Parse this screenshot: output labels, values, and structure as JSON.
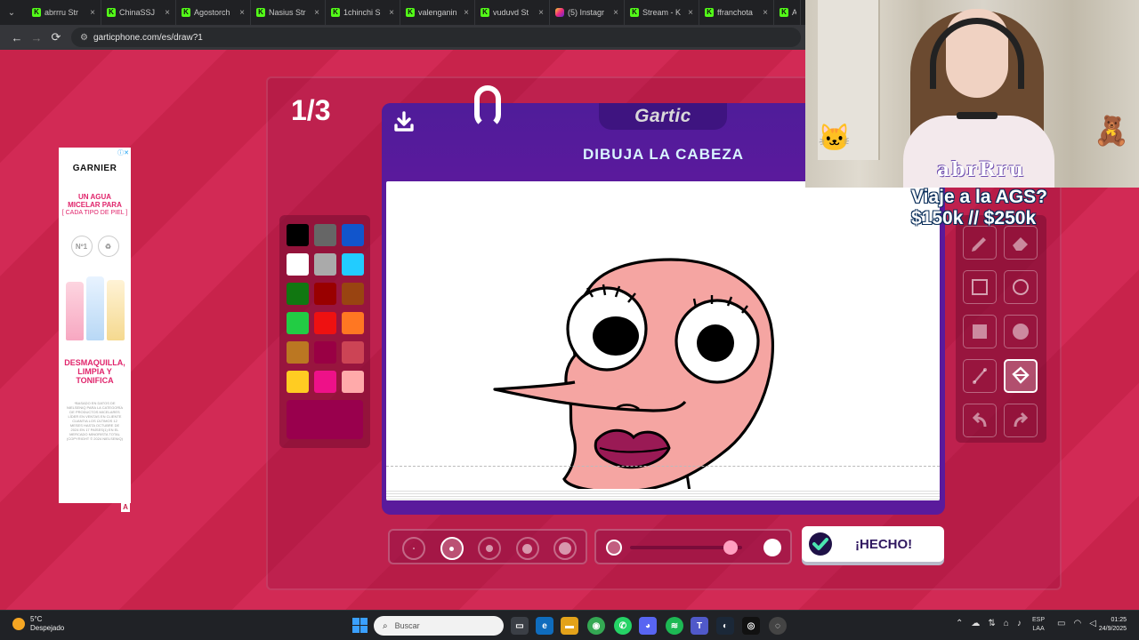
{
  "browser": {
    "tabs": [
      {
        "label": "abrrru Str",
        "icon": "kick-icon"
      },
      {
        "label": "ChinaSSJ",
        "icon": "kick-icon"
      },
      {
        "label": "Agostorch",
        "icon": "kick-icon"
      },
      {
        "label": "Nasius Str",
        "icon": "kick-icon"
      },
      {
        "label": "1chinchi S",
        "icon": "kick-icon"
      },
      {
        "label": "valenganin",
        "icon": "kick-icon"
      },
      {
        "label": "vuduvd St",
        "icon": "kick-icon"
      },
      {
        "label": "(5) Instagr",
        "icon": "instagram-icon"
      },
      {
        "label": "Stream - K",
        "icon": "kick-icon"
      },
      {
        "label": "ffranchota",
        "icon": "kick-icon"
      },
      {
        "label": "A",
        "icon": "kick-icon"
      }
    ],
    "url": "garticphone.com/es/draw?1"
  },
  "game": {
    "round": "1/3",
    "logo": "Gartic",
    "instruction": "DIBUJA LA CABEZA",
    "done_label": "¡HECHO!",
    "palette": [
      "#000000",
      "#666666",
      "#1155cc",
      "#ffffff",
      "#aaaaaa",
      "#22ccff",
      "#117711",
      "#990000",
      "#994411",
      "#22cc44",
      "#ee1111",
      "#ff7722",
      "#bb7722",
      "#990044",
      "#cc4455",
      "#ffcc22",
      "#ee1188",
      "#ffaaaa"
    ],
    "current_color": "#99004d",
    "brush_sizes": 5,
    "selected_brush": 1,
    "opacity": 0.9,
    "tools": [
      {
        "name": "pencil-tool",
        "icon": "pencil-icon"
      },
      {
        "name": "eraser-tool",
        "icon": "eraser-icon"
      },
      {
        "name": "rectangle-outline-tool",
        "icon": "square-outline-icon"
      },
      {
        "name": "ellipse-outline-tool",
        "icon": "circle-outline-icon"
      },
      {
        "name": "rectangle-fill-tool",
        "icon": "square-filled-icon"
      },
      {
        "name": "ellipse-fill-tool",
        "icon": "circle-filled-icon"
      },
      {
        "name": "line-tool",
        "icon": "line-icon"
      },
      {
        "name": "fill-bucket-tool",
        "icon": "bucket-icon",
        "selected": true
      },
      {
        "name": "undo-tool",
        "icon": "undo-icon"
      },
      {
        "name": "redo-tool",
        "icon": "redo-icon"
      }
    ]
  },
  "ad": {
    "brand": "GARNIER",
    "headline": "UN AGUA MICELAR PARA",
    "subline": "[ CADA TIPO DE PIEL ]",
    "badge_1": "Nº1",
    "tagline": "DESMAQUILLA, LIMPIA Y TONIFICA",
    "fine_print": "*BASADO EN DATOS DE NIELSENIQ PARA LA CATEGORÍA DE PRODUCTOS MICELARES LÍDER EN VENTAS EN CLIENTE CUANTIA LOS ÚLTIMOS 12 MESES HASTA OCTUBRE DE 2024 EN 17 PAÍSES(1) EN EL MERCADO MINORISTA TOTAL (COPYRIGHT © 2024 NIELSENIQ)",
    "marker": "A"
  },
  "stream": {
    "name": "abrRru",
    "goal_line1": "Viaje a la AGS?",
    "goal_line2": "$150k // $250k"
  },
  "taskbar": {
    "temperature": "5°C",
    "weather": "Despejado",
    "search": "Buscar",
    "lang1": "ESP",
    "lang2": "LAA",
    "time": "01:25",
    "date": "24/9/2025"
  }
}
